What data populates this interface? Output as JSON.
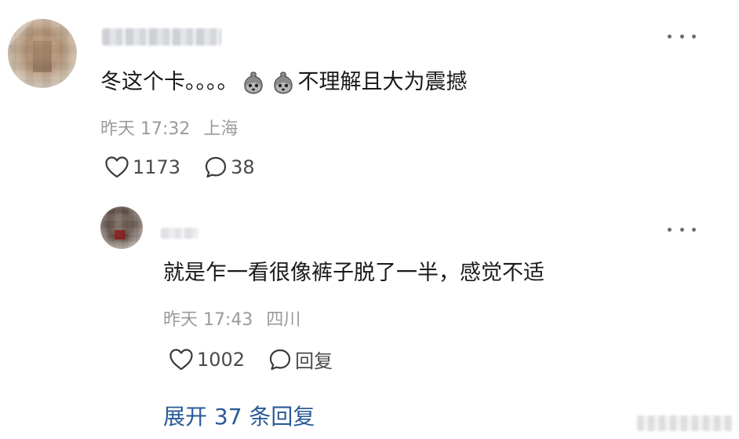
{
  "main_comment": {
    "text_before_emoji": "冬这个卡。。。。",
    "emojis": [
      "dumpling-face-icon",
      "dumpling-face-icon"
    ],
    "text_after_emoji": "不理解且大为震撼",
    "time": "昨天 17:32",
    "location": "上海",
    "likes": "1173",
    "replies": "38"
  },
  "reply_comment": {
    "text": "就是乍一看很像裤子脱了一半，感觉不适",
    "time": "昨天 17:43",
    "location": "四川",
    "likes": "1002",
    "reply_label": "回复"
  },
  "expand_replies": {
    "label": "展开 37 条回复"
  },
  "colors": {
    "link": "#2a5a96",
    "meta": "#9b9b9b",
    "text": "#1a1a1a"
  }
}
